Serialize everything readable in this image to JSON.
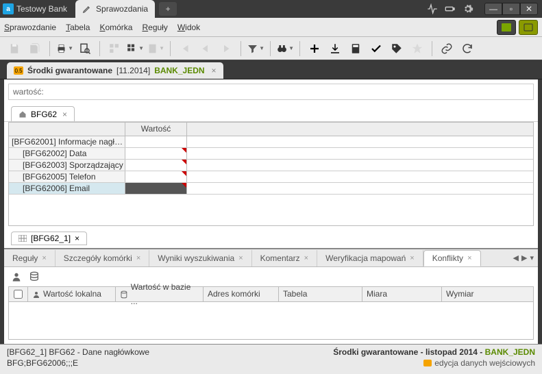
{
  "titlebar": {
    "app_title": "Testowy Bank",
    "tab_label": "Sprawozdania"
  },
  "menubar": {
    "items": [
      "Sprawozdanie",
      "Tabela",
      "Komórka",
      "Reguły",
      "Widok"
    ]
  },
  "doc_tab": {
    "title": "Środki gwarantowane",
    "period": "[11.2014]",
    "bank": "BANK_JEDN"
  },
  "value_bar": {
    "label": "wartość:",
    "value": ""
  },
  "sheet_tab": {
    "label": "BFG62"
  },
  "grid": {
    "col_header": "Wartość",
    "rows": [
      {
        "id": "[BFG62001] Informacje nagłó...",
        "indent": false
      },
      {
        "id": "[BFG62002] Data",
        "indent": true,
        "flag": true
      },
      {
        "id": "[BFG62003] Sporządzający",
        "indent": true,
        "flag": true
      },
      {
        "id": "[BFG62005] Telefon",
        "indent": true,
        "flag": true
      },
      {
        "id": "[BFG62006] Email",
        "indent": true,
        "flag": true,
        "active": true,
        "selected": true
      }
    ]
  },
  "mini_tab": {
    "label": "[BFG62_1]"
  },
  "bottom_tabs": {
    "items": [
      "Reguły",
      "Szczegóły komórki",
      "Wyniki wyszukiwania",
      "Komentarz",
      "Weryfikacja mapowań",
      "Konflikty"
    ],
    "active": 5
  },
  "conflict_cols": [
    "Wartość lokalna",
    "Wartość w bazie ...",
    "Adres komórki",
    "Tabela",
    "Miara",
    "Wymiar"
  ],
  "status": {
    "l1": "[BFG62_1] BFG62 - Dane nagłówkowe",
    "l2": "BFG;BFG62006;;;E",
    "r1_a": "Środki gwarantowane - listopad 2014 - ",
    "r1_b": "BANK_JEDN",
    "r2": "edycja danych wejściowych"
  }
}
